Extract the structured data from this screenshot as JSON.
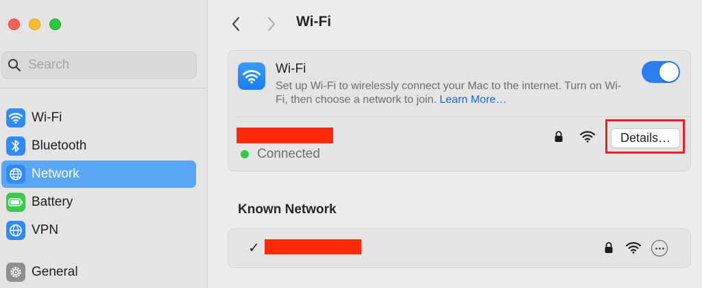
{
  "window": {
    "title": "Wi-Fi"
  },
  "sidebar": {
    "search_placeholder": "Search",
    "items": [
      {
        "label": "Wi-Fi",
        "icon": "wifi-icon",
        "color": "#2f8cf6"
      },
      {
        "label": "Bluetooth",
        "icon": "bluetooth-icon",
        "color": "#2f8cf6"
      },
      {
        "label": "Network",
        "icon": "globe-icon",
        "color": "#2f8cf6",
        "active": true
      },
      {
        "label": "Battery",
        "icon": "battery-icon",
        "color": "#3ec850"
      },
      {
        "label": "VPN",
        "icon": "vpn-globe-icon",
        "color": "#2f8cf6"
      },
      {
        "label": "General",
        "icon": "gear-icon",
        "color": "#8e8e93"
      }
    ]
  },
  "wifi_card": {
    "title": "Wi-Fi",
    "description": "Set up Wi-Fi to wirelessly connect your Mac to the internet. Turn on Wi-Fi, then choose a network to join.",
    "learn_more": "Learn More…",
    "toggle_on": true,
    "status": "Connected",
    "details_label": "Details…"
  },
  "known_network": {
    "section_title": "Known Network"
  },
  "colors": {
    "accent": "#2c7ef0",
    "sidebar_active": "#59a7f5",
    "redaction": "#ff2a0c",
    "highlight": "#ee1d23",
    "connected_dot": "#31c846"
  }
}
